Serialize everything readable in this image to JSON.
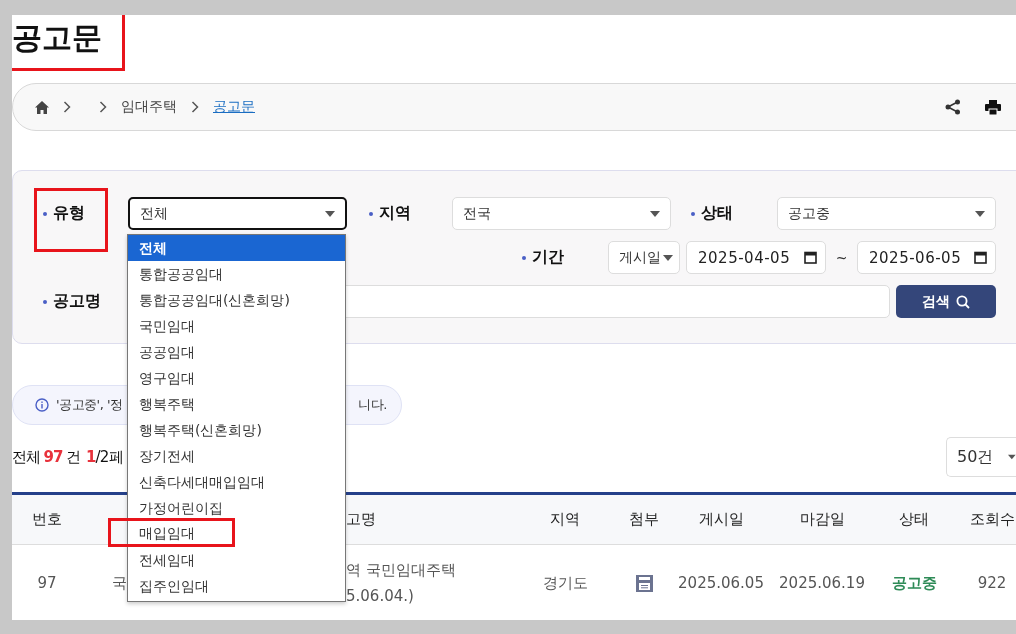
{
  "page_title": {
    "text": "공고문",
    "highlighted": true
  },
  "breadcrumb": {
    "items": [
      {
        "label": "임대주택",
        "current": false
      },
      {
        "label": "공고문",
        "current": true
      }
    ]
  },
  "filters": {
    "type": {
      "label": "유형",
      "value": "전체",
      "highlighted": true,
      "focused": true
    },
    "region": {
      "label": "지역",
      "value": "전국",
      "focused": false
    },
    "status": {
      "label": "상태",
      "value": "공고중",
      "focused": false
    },
    "period": {
      "label": "기간",
      "basis": "게시일",
      "from": "2025-04-05",
      "separator": "~",
      "to": "2025-06-05"
    },
    "title": {
      "label": "공고명"
    },
    "search_button": "검색"
  },
  "type_dropdown": {
    "options": [
      {
        "label": "전체",
        "selected": true,
        "highlighted": false
      },
      {
        "label": "통합공공임대",
        "selected": false,
        "highlighted": false
      },
      {
        "label": "통합공공임대(신혼희망)",
        "selected": false,
        "highlighted": false
      },
      {
        "label": "국민임대",
        "selected": false,
        "highlighted": false
      },
      {
        "label": "공공임대",
        "selected": false,
        "highlighted": false
      },
      {
        "label": "영구임대",
        "selected": false,
        "highlighted": false
      },
      {
        "label": "행복주택",
        "selected": false,
        "highlighted": false
      },
      {
        "label": "행복주택(신혼희망)",
        "selected": false,
        "highlighted": false
      },
      {
        "label": "장기전세",
        "selected": false,
        "highlighted": false
      },
      {
        "label": "신축다세대매입임대",
        "selected": false,
        "highlighted": false
      },
      {
        "label": "가정어린이집",
        "selected": false,
        "highlighted": false
      },
      {
        "label": "매입임대",
        "selected": false,
        "highlighted": true
      },
      {
        "label": "전세임대",
        "selected": false,
        "highlighted": false
      },
      {
        "label": "집주인임대",
        "selected": false,
        "highlighted": false
      }
    ]
  },
  "notice": {
    "text_start": "'공고중', '정",
    "text_end": "니다."
  },
  "summary": {
    "total_label": "전체",
    "total": "97",
    "total_unit": "건",
    "page": "1",
    "page_rest": "/2페"
  },
  "page_size": "50건",
  "table": {
    "columns": [
      {
        "label": "번호"
      },
      {
        "label": "고명"
      },
      {
        "label": "지역"
      },
      {
        "label": "첨부"
      },
      {
        "label": "게시일"
      },
      {
        "label": "마감일"
      },
      {
        "label": "상태"
      },
      {
        "label": "조회수"
      }
    ],
    "rows": [
      {
        "number": "97",
        "type": "국",
        "title_lines": [
          "역 국민임대주택",
          "5.06.04.)"
        ],
        "region": "경기도",
        "attachment": true,
        "posted": "2025.06.05",
        "deadline": "2025.06.19",
        "status": "공고중",
        "views": "922"
      }
    ]
  }
}
